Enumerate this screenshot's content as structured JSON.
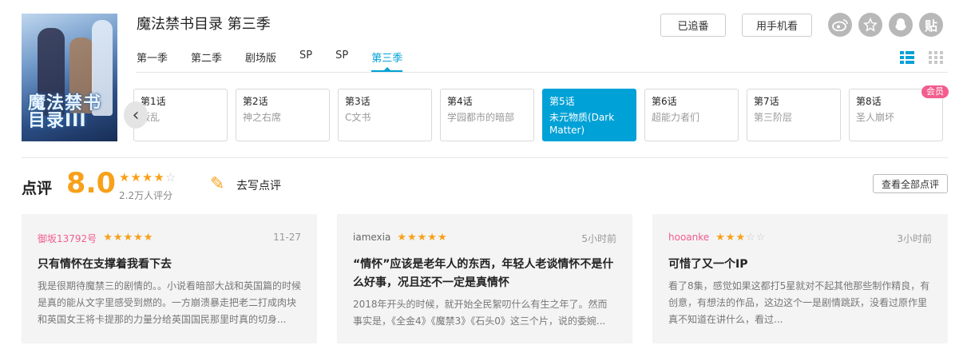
{
  "poster": {
    "title_art": "魔法禁书目录III"
  },
  "title": "魔法禁书目录 第三季",
  "seasons": [
    "第一季",
    "第二季",
    "剧场版",
    "SP",
    "SP",
    "第三季"
  ],
  "active_season": 5,
  "buttons": {
    "follow": "已追番",
    "phone": "用手机看",
    "tieba": "贴"
  },
  "share_icons": [
    "weibo-icon",
    "qzone-icon",
    "qq-icon",
    "tieba-icon"
  ],
  "episodes": [
    {
      "num": "第1话",
      "name": "叛乱"
    },
    {
      "num": "第2话",
      "name": "神之右席"
    },
    {
      "num": "第3话",
      "name": "C文书"
    },
    {
      "num": "第4话",
      "name": "学园都市的暗部"
    },
    {
      "num": "第5话",
      "name": "未元物质(Dark Matter)"
    },
    {
      "num": "第6话",
      "name": "超能力者们"
    },
    {
      "num": "第7话",
      "name": "第三阶层"
    },
    {
      "num": "第8话",
      "name": "圣人崩坏"
    }
  ],
  "active_episode": 4,
  "vip_badge": "会员",
  "rating": {
    "label": "点评",
    "score": "8.0",
    "stars_filled": 4,
    "stars_total": 5,
    "count": "2.2万人评分",
    "write": "去写点评",
    "all": "查看全部点评"
  },
  "reviews": [
    {
      "user": "御坂13792号",
      "user_color": "#f25d8e",
      "stars": 5,
      "time": "11-27",
      "title": "只有情怀在支撑着我看下去",
      "body": "我是很期待魔禁三的剧情的。。小说看暗部大战和英国篇的时候是真的能从文字里感受到燃的。一方崩溃暴走把老二打成肉块和英国女王将卡提那的力量分给英国国民那里时真的切身..."
    },
    {
      "user": "iamexia",
      "user_color": "#666666",
      "stars": 5,
      "time": "5小时前",
      "title": "“情怀”应该是老年人的东西，年轻人老谈情怀不是什么好事，况且还不一定是真情怀",
      "body": "2018年开头的时候，就开始全民絮叨什么有生之年了。然而事实是，《全金4》《魔禁3》《石头0》这三个片，说的委婉..."
    },
    {
      "user": "hooanke",
      "user_color": "#f25d8e",
      "stars": 3,
      "time": "3小时前",
      "title": "可惜了又一个IP",
      "body": "看了8集，感觉如果这都打5星就对不起其他那些制作精良，有创意，有想法的作品，这边这个一是剧情跳跃，没看过原作里真不知道在讲什么，看过..."
    }
  ],
  "colors": {
    "accent": "#00a1d6",
    "star": "#f7a11a",
    "pink": "#f25d8e"
  }
}
